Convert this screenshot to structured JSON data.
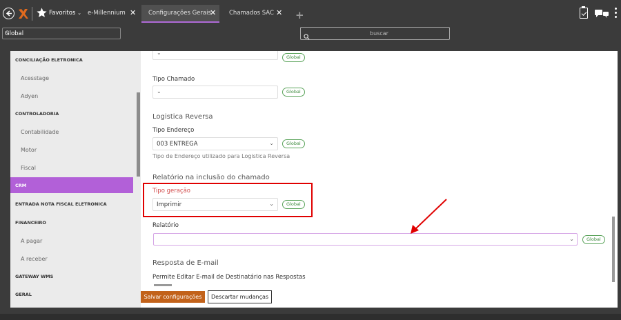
{
  "topbar": {
    "favorites_label": "Favoritos",
    "tabs": [
      {
        "label": "e-Millennium",
        "close": "✕"
      },
      {
        "label": "Configurações Gerais",
        "close": "✕"
      },
      {
        "label": "Chamados SAC",
        "close": "✕"
      }
    ],
    "add_tab": "+"
  },
  "filter": {
    "scope_value": "Global",
    "search_placeholder": "buscar"
  },
  "sidebar": {
    "items": [
      {
        "label": "CONCILIAÇÃO ELETRONICA",
        "kind": "section"
      },
      {
        "label": "Acesstage",
        "kind": "sub"
      },
      {
        "label": "Adyen",
        "kind": "sub"
      },
      {
        "label": "CONTROLADORIA",
        "kind": "section"
      },
      {
        "label": "Contabilidade",
        "kind": "sub"
      },
      {
        "label": "Motor",
        "kind": "sub"
      },
      {
        "label": "Fiscal",
        "kind": "sub"
      },
      {
        "label": "CRM",
        "kind": "active"
      },
      {
        "label": "ENTRADA NOTA FISCAL ELETRONICA",
        "kind": "section"
      },
      {
        "label": "FINANCEIRO",
        "kind": "section"
      },
      {
        "label": "A pagar",
        "kind": "sub"
      },
      {
        "label": "A receber",
        "kind": "sub"
      },
      {
        "label": "GATEWAY WMS",
        "kind": "section"
      },
      {
        "label": "GERAL",
        "kind": "section"
      }
    ]
  },
  "main": {
    "badge": "Global",
    "tipo_chamado_label": "Tipo Chamado",
    "logistica_title": "Logistica Reversa",
    "tipo_endereco_label": "Tipo Endereço",
    "tipo_endereco_value": "003 ENTREGA",
    "tipo_endereco_help": "Tipo de Endereço utilizado para Logistica Reversa",
    "relatorio_section_title": "Relatório na inclusão do chamado",
    "tipo_geracao_label": "Tipo geração",
    "tipo_geracao_value": "Imprimir",
    "relatorio_label": "Relatório",
    "relatorio_value": "",
    "email_section_title": "Resposta de E-mail",
    "permite_label": "Permite Editar E-mail de Destinatário nas Respostas"
  },
  "actions": {
    "save_label": "Salvar configurações",
    "discard_label": "Descartar mudanças"
  },
  "colors": {
    "accent": "#b260d8",
    "highlight": "#e00000",
    "save": "#c2621a",
    "badge": "#3c8a3c"
  }
}
